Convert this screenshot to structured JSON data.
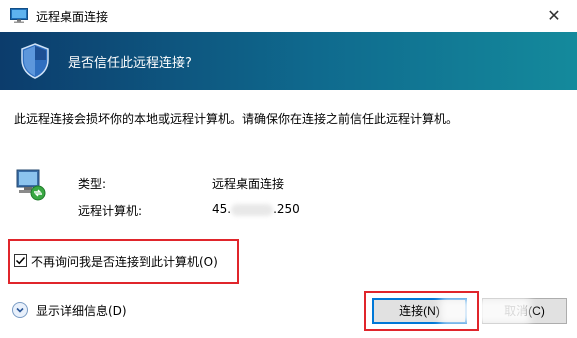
{
  "window": {
    "title": "远程桌面连接",
    "close_glyph": "✕"
  },
  "banner": {
    "question": "是否信任此远程连接?",
    "icon": "shield-icon"
  },
  "warning_text": "此远程连接会损坏你的本地或远程计算机。请确保你在连接之前信任此远程计算机。",
  "info": {
    "icon": "remote-pc-icon",
    "type_label": "类型:",
    "type_value": "远程桌面连接",
    "computer_label": "远程计算机:",
    "computer_prefix": "45.",
    "computer_suffix": ".250"
  },
  "checkbox": {
    "label": "不再询问我是否连接到此计算机(O)",
    "checked": true
  },
  "details": {
    "label": "显示详细信息(D)"
  },
  "buttons": {
    "connect": "连接(N)",
    "cancel": "取消(C)"
  },
  "colors": {
    "accent": "#0078d7",
    "highlight": "#e0252b",
    "banner_start": "#0c3c6c",
    "banner_end": "#148a9c"
  }
}
